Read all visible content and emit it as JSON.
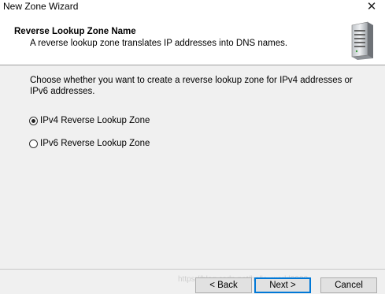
{
  "window": {
    "title": "New Zone Wizard",
    "close_glyph": "✕"
  },
  "header": {
    "title": "Reverse Lookup Zone Name",
    "subtitle": "A reverse lookup zone translates IP addresses into DNS names.",
    "icon": "server-icon"
  },
  "content": {
    "prompt": "Choose whether you want to create a reverse lookup zone for IPv4 addresses or IPv6 addresses.",
    "options": [
      {
        "label": "IPv4 Reverse Lookup Zone",
        "checked": true
      },
      {
        "label": "IPv6 Reverse Lookup Zone",
        "checked": false
      }
    ]
  },
  "buttons": {
    "back": "< Back",
    "next": "Next >",
    "cancel": "Cancel"
  },
  "watermark": "https://blog.csdn.net/hello_world9990"
}
